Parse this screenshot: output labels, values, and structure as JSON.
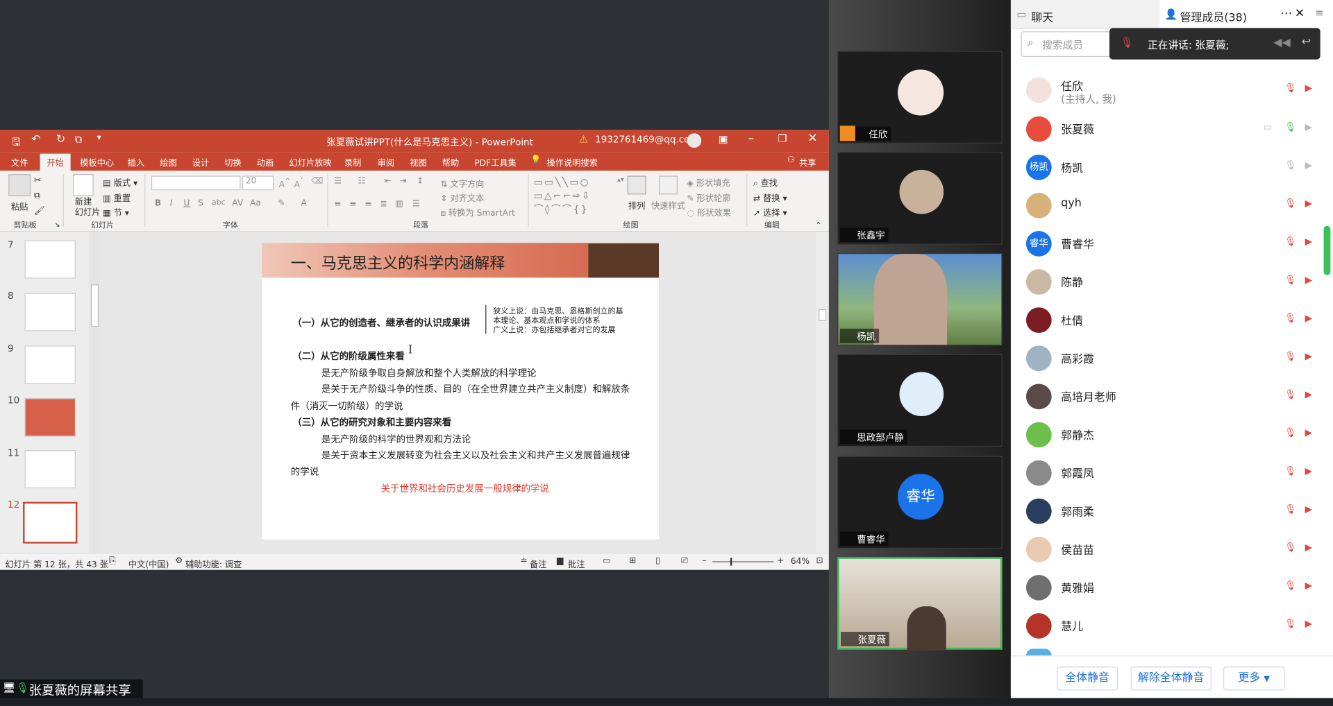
{
  "ppt": {
    "title": "张夏薇试讲PPT(什么是马克思主义) - PowerPoint",
    "account": "1932761469@qq.com",
    "tabs": [
      "文件",
      "开始",
      "模板中心",
      "插入",
      "绘图",
      "设计",
      "切换",
      "动画",
      "幻灯片放映",
      "录制",
      "审阅",
      "视图",
      "帮助",
      "PDF工具集"
    ],
    "search_hint": "操作说明搜索",
    "share_btn": "共享",
    "ribbon": {
      "paste": "粘贴",
      "new_slide": "新建\n幻灯片",
      "layout": "版式",
      "reset": "重置",
      "section": "节",
      "font_size": "20",
      "text_dir": "文字方向",
      "align_text": "对齐文本",
      "smartart": "转换为 SmartArt",
      "arrange": "排列",
      "quick_style": "快速样式",
      "shape_fill": "形状填充",
      "shape_outline": "形状轮廓",
      "shape_effect": "形状效果",
      "find": "查找",
      "replace": "替换",
      "select": "选择",
      "groups": [
        "剪贴板",
        "幻灯片",
        "字体",
        "段落",
        "绘图",
        "编辑"
      ]
    },
    "thumb_numbers": [
      "7",
      "8",
      "9",
      "10",
      "11",
      "12"
    ],
    "slide": {
      "heading": "一、马克思主义的科学内涵解释",
      "p1": "（一）从它的创造者、继承者的认识成果讲",
      "side1": "狭义上说：由马克思、恩格斯创立的基",
      "side2": "本理论、基本观点和学说的体系",
      "side3": "广义上说：亦包括继承者对它的发展",
      "p2": "（二）从它的阶级属性来看",
      "p3": "是无产阶级争取自身解放和整个人类解放的科学理论",
      "p4a": "是关于无产阶级斗争的性质、目的（在全世界建立共产主义制度）和解放条",
      "p4b": "件（消灭一切阶级）的学说",
      "p5": "（三）从它的研究对象和主要内容来看",
      "p6": "是无产阶级的科学的世界观和方法论",
      "p7a": "是关于资本主义发展转变为社会主义以及社会主义和共产主义发展普遍规律",
      "p7b": "的学说",
      "p8": "关于世界和社会历史发展一般规律的学说"
    },
    "status": {
      "slide_info": "幻灯片 第 12 张，共 43 张",
      "lang": "中文(中国)",
      "accessibility": "辅助功能: 调查",
      "notes": "备注",
      "comments": "批注",
      "zoom": "64%"
    }
  },
  "share_label": "张夏薇的屏幕共享",
  "video_tiles": [
    "任欣",
    "张鑫宇",
    "杨凯",
    "思政部卢静",
    "曹睿华",
    "张夏薇"
  ],
  "video_avatar_text": "睿华",
  "panel": {
    "tab_chat": "聊天",
    "tab_members": "管理成员(38)",
    "search_placeholder": "搜索成员",
    "speaking": "正在讲话: 张夏薇;",
    "members": [
      {
        "name": "任欣",
        "sub": "(主持人, 我)"
      },
      {
        "name": "张夏薇"
      },
      {
        "name": "杨凯",
        "avatar_text": "杨凯"
      },
      {
        "name": "qyh"
      },
      {
        "name": "曹睿华",
        "avatar_text": "睿华"
      },
      {
        "name": "陈静"
      },
      {
        "name": "杜倩"
      },
      {
        "name": "高彩霞"
      },
      {
        "name": "高培月老师"
      },
      {
        "name": "郭静杰"
      },
      {
        "name": "郭霞凤"
      },
      {
        "name": "郭雨柔"
      },
      {
        "name": "侯苗苗"
      },
      {
        "name": "黄雅娟"
      },
      {
        "name": "慧儿"
      }
    ],
    "btn_mute_all": "全体静音",
    "btn_unmute_all": "解除全体静音",
    "btn_more": "更多"
  },
  "colors": {
    "ppt_red": "#c8452f",
    "accent_blue": "#1e6fd9",
    "mic_green": "#3cc15a"
  }
}
